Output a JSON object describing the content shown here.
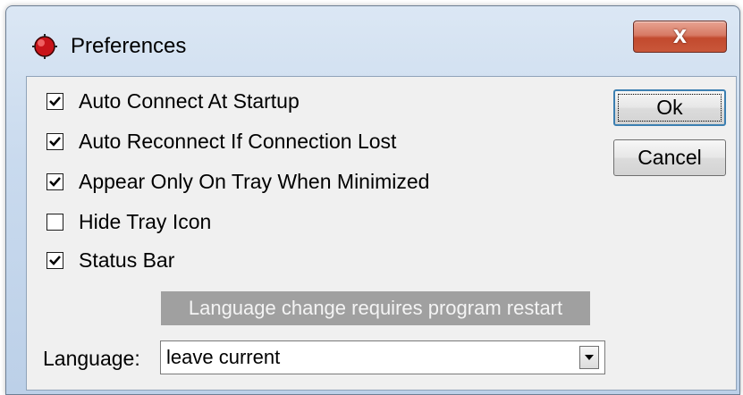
{
  "window": {
    "title": "Preferences",
    "close_label": "X"
  },
  "options": [
    {
      "label": "Auto Connect At Startup",
      "checked": true
    },
    {
      "label": "Auto Reconnect If Connection Lost",
      "checked": true
    },
    {
      "label": "Appear Only On Tray When Minimized",
      "checked": true
    },
    {
      "label": "Hide Tray Icon",
      "checked": false
    },
    {
      "label": "Status Bar",
      "checked": true
    }
  ],
  "buttons": {
    "ok_label": "Ok",
    "cancel_label": "Cancel"
  },
  "language": {
    "notice": "Language change requires program restart",
    "label": "Language:",
    "selected": "leave current"
  },
  "icons": {
    "app": "app-icon",
    "close": "close-icon",
    "check": "check-icon",
    "dropdown": "chevron-down-icon"
  },
  "colors": {
    "close_button": "#c9573a",
    "notice_background": "#a0a0a0",
    "dialog_background": "#f0f0f0"
  }
}
